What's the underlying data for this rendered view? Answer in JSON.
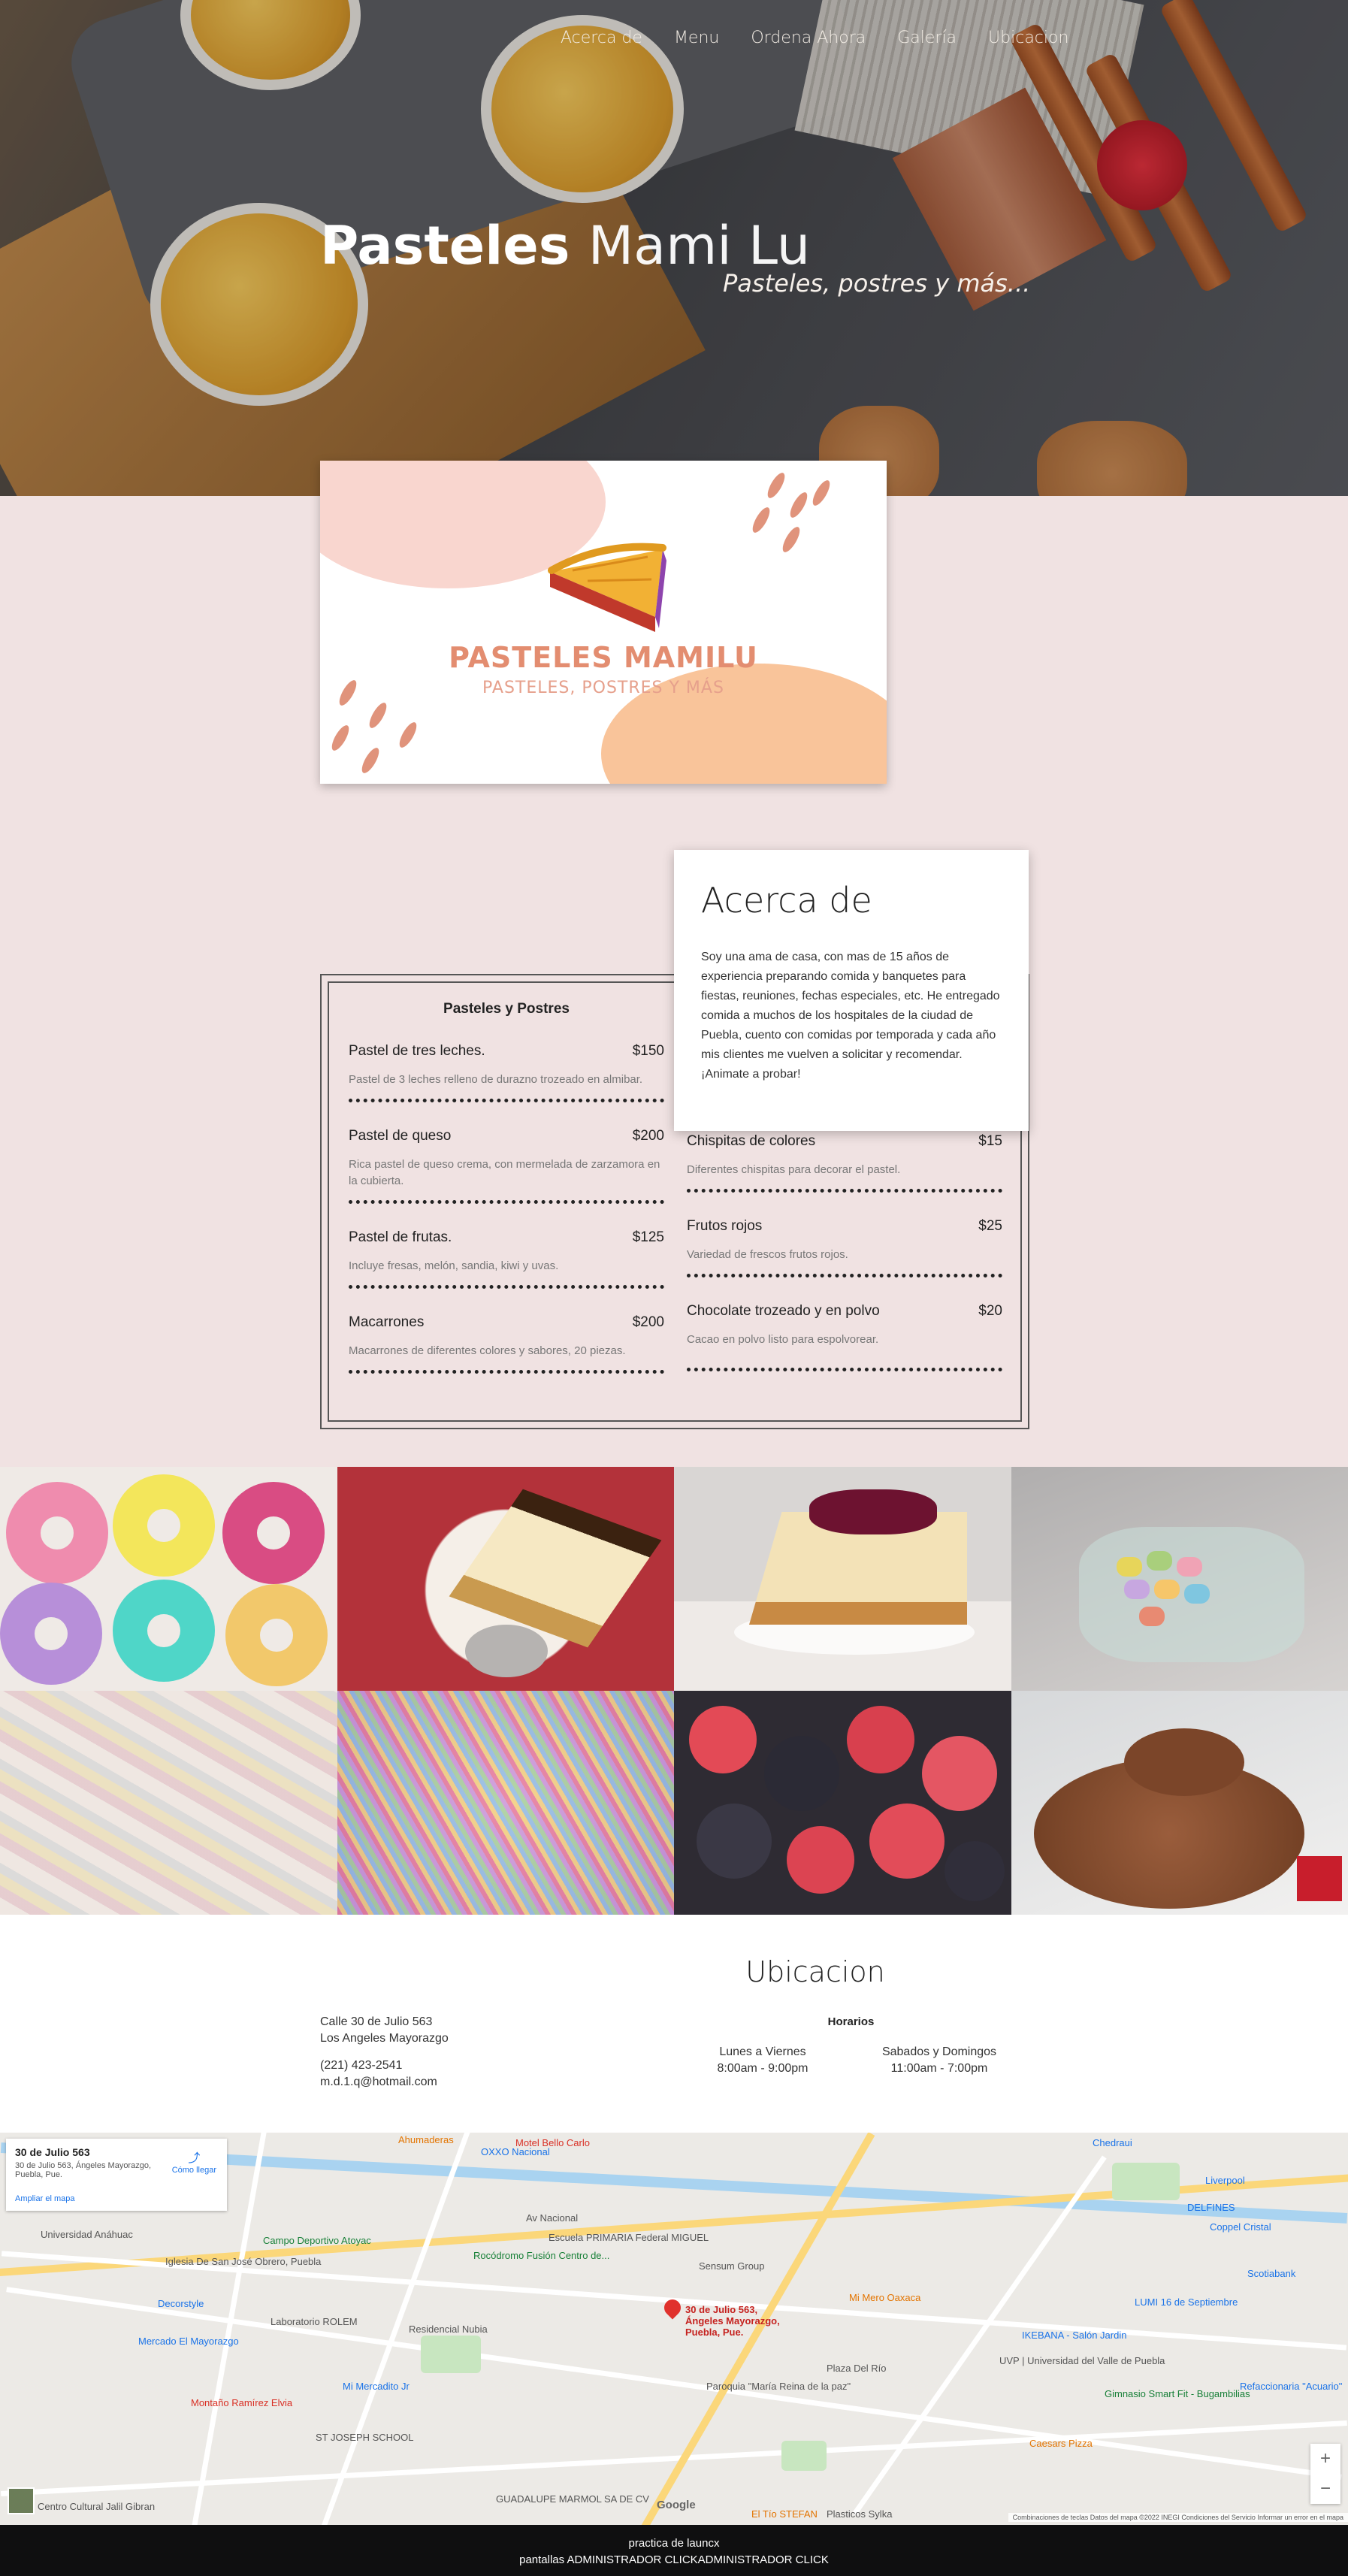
{
  "nav": {
    "items": [
      "Acerca de",
      "Menu",
      "Ordena Ahora",
      "Galería",
      "Ubicacion"
    ]
  },
  "hero": {
    "title_bold": "Pasteles",
    "title_light": "Mami Lu",
    "subtitle": "Pasteles, postres y más..."
  },
  "logo": {
    "name": "PASTELES MAMILU",
    "tagline": "PASTELES, POSTRES Y MÁS"
  },
  "about": {
    "title": "Acerca de",
    "text": "Soy una ama de casa, con mas de 15 años de experiencia preparando comida y banquetes para fiestas, reuniones, fechas especiales, etc. He entregado comida a muchos de los hospitales de la ciudad de Puebla, cuento con comidas por temporada y cada año mis clientes me vuelven a solicitar y recomendar. ¡Animate a probar!"
  },
  "menu": {
    "heading": "Pasteles y Postres",
    "left": [
      {
        "name": "Pastel de tres leches.",
        "price": "$150",
        "desc": "Pastel de 3 leches relleno de durazno trozeado en almibar."
      },
      {
        "name": "Pastel de queso",
        "price": "$200",
        "desc": "Rica pastel de queso crema, con mermelada de zarzamora en la cubierta."
      },
      {
        "name": "Pastel de frutas.",
        "price": "$125",
        "desc": "Incluye fresas, melón, sandia, kiwi y uvas."
      },
      {
        "name": "Macarrones",
        "price": "$200",
        "desc": "Macarrones de diferentes colores y sabores, 20 piezas."
      }
    ],
    "right": [
      {
        "name": "Chispitas de colores",
        "price": "$15",
        "desc": "Diferentes chispitas para decorar el pastel."
      },
      {
        "name": "Frutos rojos",
        "price": "$25",
        "desc": "Variedad de frescos frutos rojos."
      },
      {
        "name": "Chocolate trozeado y en polvo",
        "price": "$20",
        "desc": "Cacao en polvo listo para espolvorear."
      }
    ]
  },
  "location": {
    "title": "Ubicacion",
    "address_line1": "Calle 30 de Julio 563",
    "address_line2": "Los Angeles Mayorazgo",
    "phone": "(221) 423-2541",
    "email": "m.d.1.q@hotmail.com",
    "hours_title": "Horarios",
    "weekdays_label": "Lunes a Viernes",
    "weekdays_hours": "8:00am - 9:00pm",
    "weekend_label": "Sabados y Domingos",
    "weekend_hours": "11:00am - 7:00pm"
  },
  "map": {
    "card_title": "30 de Julio 563",
    "card_address": "30 de Julio 563, Ángeles Mayorazgo, Puebla, Pue.",
    "directions": "Cómo llegar",
    "enlarge": "Ampliar el mapa",
    "pin_label": "30 de Julio 563, Ángeles Mayorazgo, Puebla, Pue.",
    "labels": [
      "Av Nacional",
      "Universidad Anáhuac",
      "Mercado El Mayorazgo",
      "Mi Mercadito Jr",
      "Montaño Ramírez Elvia",
      "ST JOSEPH SCHOOL",
      "DELFINES",
      "Coppel Cristal",
      "Scotiabank",
      "LUMI 16 de Septiembre",
      "IKEBANA - Salón Jardin",
      "Caesars Pizza",
      "Mi Mero Oaxaca",
      "Plaza Del Río",
      "Residencial Nubia",
      "Escuela PRIMARIA Federal MIGUEL",
      "Campo Deportivo Atoyac",
      "Ahumaderas",
      "OXXO Nacional",
      "Motel Bello Carlo",
      "Chedraui",
      "Liverpool",
      "Gimnasio Smart Fit - Bugambilias",
      "Refaccionaria \"Acuario\"",
      "UVP | Universidad del Valle de Puebla",
      "El Tío STEFAN",
      "Centro Cultural Jalil Gibran",
      "GUADALUPE MARMOL SA DE CV",
      "Laboratorio ROLEM",
      "Decorstyle",
      "Iglesia De San José Obrero, Puebla",
      "Rocódromo Fusión Centro de...",
      "Sensum Group",
      "Paroquia \"María Reina de la paz\"",
      "Plasticos Sylka",
      "Google"
    ],
    "footer": "Combinaciones de teclas   Datos del mapa ©2022 INEGI   Condiciones del Servicio   Informar un error en el mapa"
  },
  "footer": {
    "line1": "practica de launcx",
    "line2": "pantallas ADMINISTRADOR CLICKADMINISTRADOR CLICK"
  }
}
